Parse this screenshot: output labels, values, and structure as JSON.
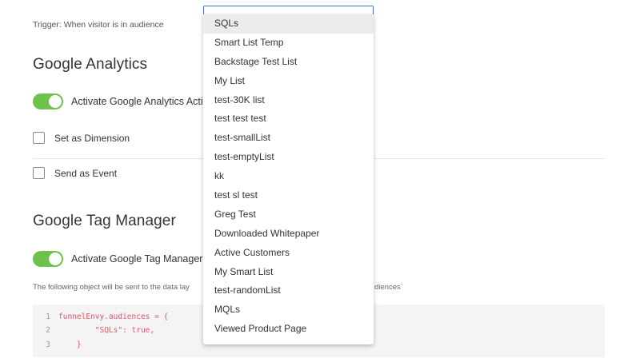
{
  "trigger": "Trigger: When visitor is in audience",
  "google_analytics": {
    "title": "Google Analytics",
    "activate_label": "Activate Google Analytics Actio",
    "set_dimension_label": "Set as Dimension",
    "send_event_label": "Send as Event"
  },
  "google_tag_manager": {
    "title": "Google Tag Manager",
    "activate_label": "Activate Google Tag Manager A",
    "info_text": "The following object will be sent to the data lay",
    "info_tail": "diences`"
  },
  "code": {
    "lines": [
      {
        "num": "1",
        "text": "funnelEnvy.audiences = {"
      },
      {
        "num": "2",
        "text": "        \"SQLs\": true,"
      },
      {
        "num": "3",
        "text": "    }"
      }
    ]
  },
  "dropdown": {
    "items": [
      "SQLs",
      "Smart List Temp",
      "Backstage Test List",
      "My List",
      "test-30K list",
      "test test test",
      "test-smallList",
      "test-emptyList",
      "kk",
      "test sl test",
      "Greg Test",
      "Downloaded Whitepaper",
      "Active Customers",
      "My Smart List",
      "test-randomList",
      "MQLs",
      "Viewed Product Page"
    ],
    "selected": "SQLs"
  },
  "colors": {
    "toggle_on": "#6cc24a",
    "code_text": "#e0566a",
    "dropdown_border": "#4a6cd4"
  }
}
